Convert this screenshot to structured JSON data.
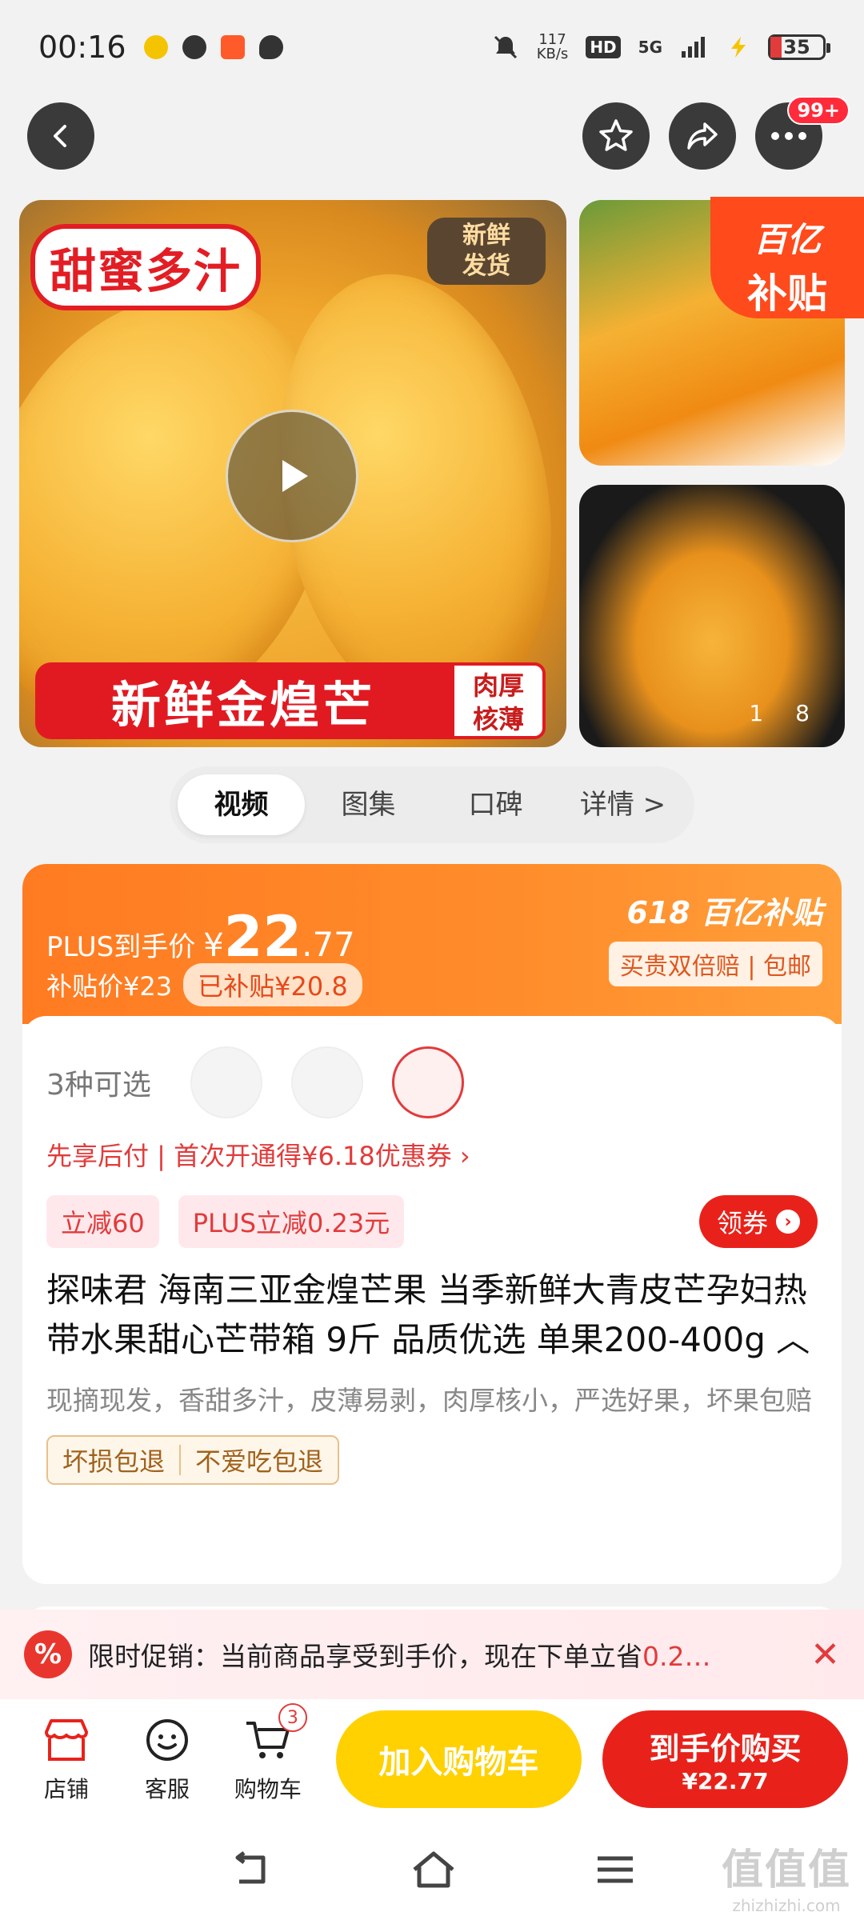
{
  "status_bar": {
    "time": "00:16",
    "net_speed": "117",
    "net_unit": "KB/s",
    "hd": "HD",
    "network": "5G",
    "battery": "35"
  },
  "gallery": {
    "main_tag": "甜蜜多汁",
    "fresh_ship": [
      "新鲜",
      "发货"
    ],
    "banner": "新鲜金煌芒",
    "thick_tag": [
      "肉厚",
      "核薄"
    ],
    "subsidy_corner": [
      "百亿",
      "补贴"
    ],
    "counter_current": "1",
    "counter_total": "8"
  },
  "nav": {
    "more_badge": "99+"
  },
  "tabs": [
    {
      "label": "视频",
      "active": true
    },
    {
      "label": "图集",
      "active": false
    },
    {
      "label": "口碑",
      "active": false
    },
    {
      "label": "详情 >",
      "active": false
    }
  ],
  "price": {
    "plus_label": "PLUS到手价",
    "currency": "¥",
    "integer": "22",
    "decimal": ".77",
    "subsidy_price": "补贴价¥23",
    "subsidized": "已补贴¥20.8",
    "badge_618": "618 百亿补贴",
    "guarantee_tags": "买贵双倍赔 | 包邮"
  },
  "product": {
    "options_label": "3种可选",
    "pay_later": "先享后付 | 首次开通得¥6.18优惠券 ›",
    "coupons": [
      "立减60",
      "PLUS立减0.23元"
    ],
    "get_coupon": "领券",
    "title": "探味君 海南三亚金煌芒果 当季新鲜大青皮芒孕妇热带水果甜心芒带箱 9斤 品质优选 单果200-400g ︿",
    "description": "现摘现发，香甜多汁，皮薄易剥，肉厚核小，严选好果，坏果包赔",
    "guarantees": [
      "坏损包退",
      "不爱吃包退"
    ]
  },
  "promo": {
    "icon": "%",
    "text": "限时促销：当前商品享受到手价，现在下单立省",
    "highlight": "0.2…",
    "close": "✕"
  },
  "actions": {
    "shop": "店铺",
    "service": "客服",
    "cart": "购物车",
    "cart_count": "3",
    "add_to_cart": "加入购物车",
    "buy_label": "到手价购买",
    "buy_price": "¥22.77"
  },
  "watermark": {
    "logo": "值值值",
    "site": "zhizhizhi.com"
  },
  "colors": {
    "accent_red": "#e8221b",
    "orange": "#ff7b22",
    "yellow": "#ffd100"
  }
}
